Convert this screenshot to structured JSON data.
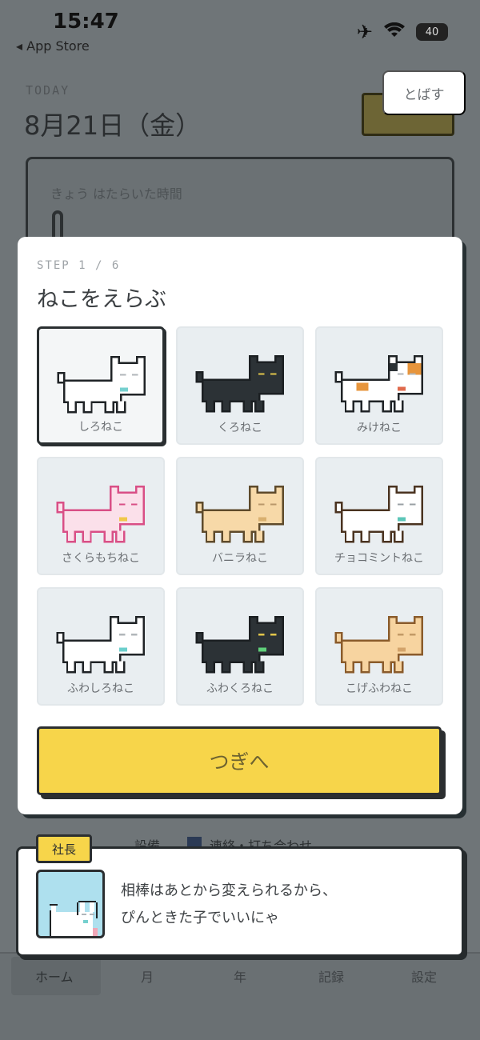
{
  "status_bar": {
    "time": "15:47",
    "back_label": "◂ App Store",
    "battery": "40"
  },
  "background": {
    "today_label": "TODAY",
    "date": "8月21日（金）",
    "card_label": "きょう はたらいた時間",
    "row_text_1": "設備",
    "row_text_2": "連絡・打ち合わせ",
    "tabs": [
      "ホーム",
      "月",
      "年",
      "記録",
      "設定"
    ]
  },
  "skip_label": "とばす",
  "modal": {
    "step": "STEP 1 / 6",
    "title": "ねこをえらぶ",
    "cats": [
      {
        "name": "しろねこ",
        "selected": true,
        "fill": "#ffffff",
        "line": "#1f2326",
        "eye": "#b0b6ba",
        "collar": "#76d0cf"
      },
      {
        "name": "くろねこ",
        "selected": false,
        "fill": "#2c3236",
        "line": "#1b1f22",
        "eye": "#e2c64a",
        "collar": "#2c3236"
      },
      {
        "name": "みけねこ",
        "selected": false,
        "fill": "#ffffff",
        "line": "#1f2326",
        "eye": "#b0b6ba",
        "collar": "#e06a4c",
        "spot1": "#e7953c",
        "spot2": "#2c3236"
      },
      {
        "name": "さくらもちねこ",
        "selected": false,
        "fill": "#fbe0ea",
        "line": "#d94f86",
        "eye": "#d94f86",
        "collar": "#f0c84a"
      },
      {
        "name": "バニラねこ",
        "selected": false,
        "fill": "#f7d9a8",
        "line": "#5e4a2b",
        "eye": "#b9986a",
        "collar": "#d9b06f"
      },
      {
        "name": "チョコミントねこ",
        "selected": false,
        "fill": "#ffffff",
        "line": "#4a3320",
        "eye": "#9aa0a4",
        "collar": "#5cc6b8"
      },
      {
        "name": "ふわしろねこ",
        "selected": false,
        "fill": "#ffffff",
        "line": "#1f2326",
        "eye": "#b0b6ba",
        "collar": "#6ccfcc"
      },
      {
        "name": "ふわくろねこ",
        "selected": false,
        "fill": "#2c3236",
        "line": "#1b1f22",
        "eye": "#e2c64a",
        "collar": "#5fd07a"
      },
      {
        "name": "こげふわねこ",
        "selected": false,
        "fill": "#f7d4a0",
        "line": "#8a5b2b",
        "eye": "#c29a66",
        "collar": "#d3a36a"
      }
    ],
    "next_label": "つぎへ"
  },
  "speech": {
    "badge": "社長",
    "line1": "相棒はあとから変えられるから、",
    "line2": "ぴんときた子でいいにゃ"
  },
  "colors": {
    "accent_yellow": "#f7d54a",
    "dim_overlay": "#6f7578",
    "card_bg": "#e9eef1"
  }
}
